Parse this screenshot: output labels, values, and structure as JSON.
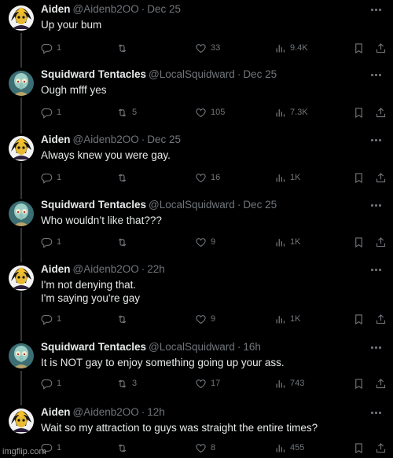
{
  "colors": {
    "background": "#000000",
    "text": "#e7e9ea",
    "muted": "#71767b",
    "divider": "#333639"
  },
  "posts": [
    {
      "name": "Aiden",
      "handle": "@Aidenb2OO",
      "dot": "·",
      "time": "Dec 25",
      "avatar": "aiden-avatar",
      "lines": [
        "Up your bum"
      ],
      "replies": "1",
      "retweets": "",
      "likes": "33",
      "views": "9.4K"
    },
    {
      "name": "Squidward Tentacles",
      "handle": "@LocalSquidward",
      "dot": "·",
      "time": "Dec 25",
      "avatar": "squidward-avatar",
      "lines": [
        "Ough mfff yes"
      ],
      "replies": "1",
      "retweets": "5",
      "likes": "105",
      "views": "7.3K"
    },
    {
      "name": "Aiden",
      "handle": "@Aidenb2OO",
      "dot": "·",
      "time": "Dec 25",
      "avatar": "aiden-avatar",
      "lines": [
        "Always knew you were gay."
      ],
      "replies": "1",
      "retweets": "",
      "likes": "16",
      "views": "1K"
    },
    {
      "name": "Squidward Tentacles",
      "handle": "@LocalSquidward",
      "dot": "·",
      "time": "Dec 25",
      "avatar": "squidward-avatar",
      "lines": [
        "Who wouldn’t like that???"
      ],
      "replies": "1",
      "retweets": "",
      "likes": "9",
      "views": "1K"
    },
    {
      "name": "Aiden",
      "handle": "@Aidenb2OO",
      "dot": "·",
      "time": "22h",
      "avatar": "aiden-avatar",
      "lines": [
        "I'm not denying that.",
        "I'm saying you're gay"
      ],
      "replies": "1",
      "retweets": "",
      "likes": "9",
      "views": "1K"
    },
    {
      "name": "Squidward Tentacles",
      "handle": "@LocalSquidward",
      "dot": "·",
      "time": "16h",
      "avatar": "squidward-avatar",
      "lines": [
        "It is NOT gay to enjoy something going up your ass."
      ],
      "replies": "1",
      "retweets": "3",
      "likes": "17",
      "views": "743"
    },
    {
      "name": "Aiden",
      "handle": "@Aidenb2OO",
      "dot": "·",
      "time": "12h",
      "avatar": "aiden-avatar",
      "lines": [
        "Wait so my attraction to guys was straight the entire times?"
      ],
      "replies": "1",
      "retweets": "",
      "likes": "8",
      "views": "455"
    }
  ],
  "watermark": "imgflip.com"
}
